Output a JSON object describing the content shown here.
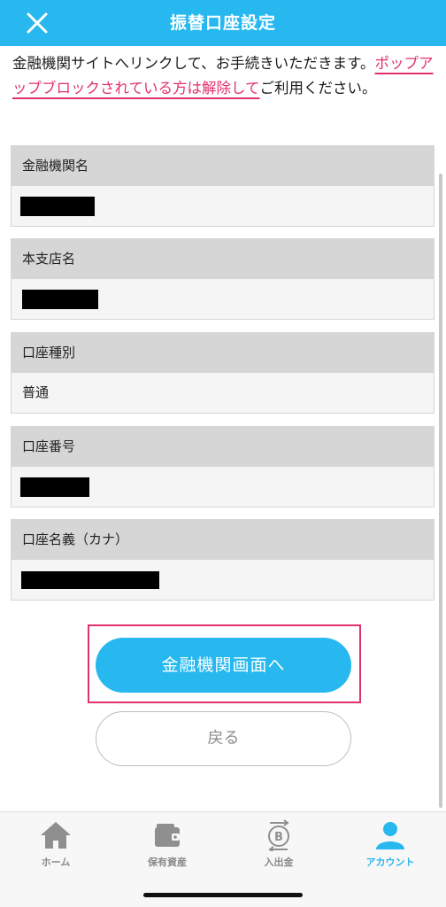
{
  "header": {
    "title": "振替口座設定"
  },
  "intro": {
    "text_before": "金融機関サイトへリンクして、お手続きいただきます。",
    "warning": "ポップアップブロックされている方は解除して",
    "text_after": "ご利用ください。"
  },
  "fields": [
    {
      "label": "金融機関名",
      "value": "",
      "redacted": true
    },
    {
      "label": "本支店名",
      "value": "",
      "redacted": true
    },
    {
      "label": "口座種別",
      "value": "普通",
      "redacted": false
    },
    {
      "label": "口座番号",
      "value": "",
      "redacted": true
    },
    {
      "label": "口座名義（カナ）",
      "value": "",
      "redacted": true
    }
  ],
  "actions": {
    "primary_label": "金融機関画面へ",
    "back_label": "戻る"
  },
  "tabbar": {
    "items": [
      {
        "label": "ホーム",
        "icon": "home-icon"
      },
      {
        "label": "保有資産",
        "icon": "wallet-icon"
      },
      {
        "label": "入出金",
        "icon": "bitcoin-transfer-icon"
      },
      {
        "label": "アカウント",
        "icon": "account-icon",
        "active": true
      }
    ]
  },
  "colors": {
    "brand": "#26b8ef",
    "warning": "#e2306c",
    "label_bg": "#d6d6d6",
    "value_bg": "#f5f5f5"
  }
}
